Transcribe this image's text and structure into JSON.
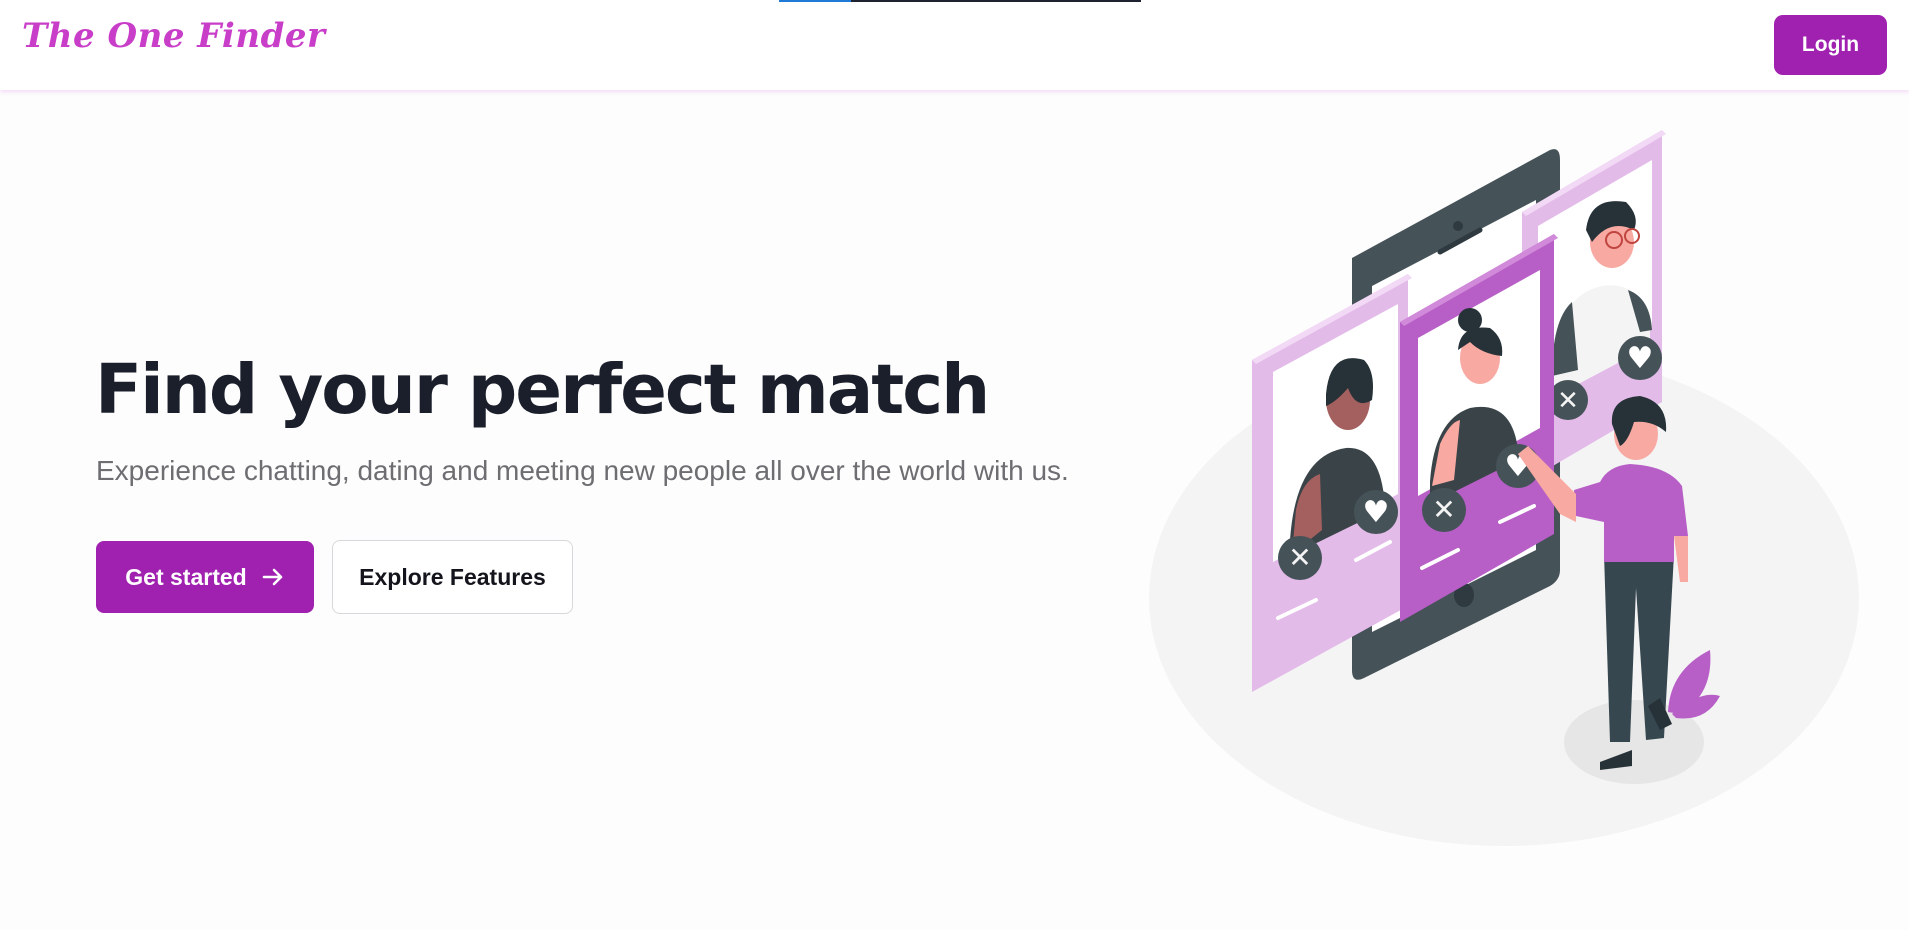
{
  "brand": {
    "name": "The One Finder"
  },
  "header": {
    "login_label": "Login"
  },
  "page_progress": {
    "fraction": 0.2
  },
  "hero": {
    "title": "Find your perfect match",
    "subtitle": "Experience chatting, dating and meeting new people all over the world with us.",
    "primary_label": "Get started",
    "secondary_label": "Explore Features"
  },
  "colors": {
    "accent": "#a020b0",
    "brand_text": "#c83ec8",
    "illustration_purple": "#b75fc6",
    "illustration_light_purple": "#e3bbe9",
    "phone_dark": "#455258"
  },
  "icons": {
    "primary_button": "arrow-right-icon",
    "dislike": "x-mark-icon",
    "like": "heart-icon"
  }
}
